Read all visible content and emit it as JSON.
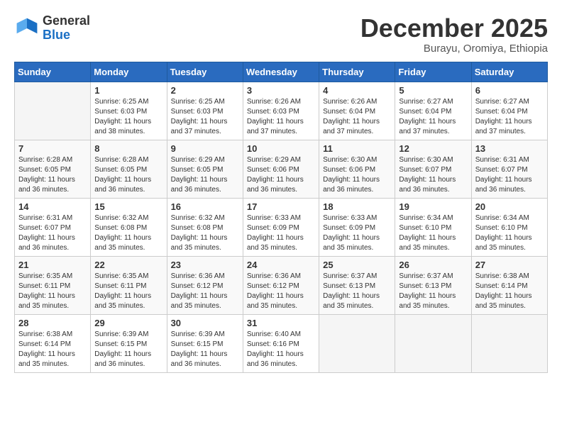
{
  "header": {
    "logo_general": "General",
    "logo_blue": "Blue",
    "month": "December 2025",
    "location": "Burayu, Oromiya, Ethiopia"
  },
  "weekdays": [
    "Sunday",
    "Monday",
    "Tuesday",
    "Wednesday",
    "Thursday",
    "Friday",
    "Saturday"
  ],
  "weeks": [
    [
      {
        "day": "",
        "info": ""
      },
      {
        "day": "1",
        "info": "Sunrise: 6:25 AM\nSunset: 6:03 PM\nDaylight: 11 hours\nand 38 minutes."
      },
      {
        "day": "2",
        "info": "Sunrise: 6:25 AM\nSunset: 6:03 PM\nDaylight: 11 hours\nand 37 minutes."
      },
      {
        "day": "3",
        "info": "Sunrise: 6:26 AM\nSunset: 6:03 PM\nDaylight: 11 hours\nand 37 minutes."
      },
      {
        "day": "4",
        "info": "Sunrise: 6:26 AM\nSunset: 6:04 PM\nDaylight: 11 hours\nand 37 minutes."
      },
      {
        "day": "5",
        "info": "Sunrise: 6:27 AM\nSunset: 6:04 PM\nDaylight: 11 hours\nand 37 minutes."
      },
      {
        "day": "6",
        "info": "Sunrise: 6:27 AM\nSunset: 6:04 PM\nDaylight: 11 hours\nand 37 minutes."
      }
    ],
    [
      {
        "day": "7",
        "info": "Sunrise: 6:28 AM\nSunset: 6:05 PM\nDaylight: 11 hours\nand 36 minutes."
      },
      {
        "day": "8",
        "info": "Sunrise: 6:28 AM\nSunset: 6:05 PM\nDaylight: 11 hours\nand 36 minutes."
      },
      {
        "day": "9",
        "info": "Sunrise: 6:29 AM\nSunset: 6:05 PM\nDaylight: 11 hours\nand 36 minutes."
      },
      {
        "day": "10",
        "info": "Sunrise: 6:29 AM\nSunset: 6:06 PM\nDaylight: 11 hours\nand 36 minutes."
      },
      {
        "day": "11",
        "info": "Sunrise: 6:30 AM\nSunset: 6:06 PM\nDaylight: 11 hours\nand 36 minutes."
      },
      {
        "day": "12",
        "info": "Sunrise: 6:30 AM\nSunset: 6:07 PM\nDaylight: 11 hours\nand 36 minutes."
      },
      {
        "day": "13",
        "info": "Sunrise: 6:31 AM\nSunset: 6:07 PM\nDaylight: 11 hours\nand 36 minutes."
      }
    ],
    [
      {
        "day": "14",
        "info": "Sunrise: 6:31 AM\nSunset: 6:07 PM\nDaylight: 11 hours\nand 36 minutes."
      },
      {
        "day": "15",
        "info": "Sunrise: 6:32 AM\nSunset: 6:08 PM\nDaylight: 11 hours\nand 35 minutes."
      },
      {
        "day": "16",
        "info": "Sunrise: 6:32 AM\nSunset: 6:08 PM\nDaylight: 11 hours\nand 35 minutes."
      },
      {
        "day": "17",
        "info": "Sunrise: 6:33 AM\nSunset: 6:09 PM\nDaylight: 11 hours\nand 35 minutes."
      },
      {
        "day": "18",
        "info": "Sunrise: 6:33 AM\nSunset: 6:09 PM\nDaylight: 11 hours\nand 35 minutes."
      },
      {
        "day": "19",
        "info": "Sunrise: 6:34 AM\nSunset: 6:10 PM\nDaylight: 11 hours\nand 35 minutes."
      },
      {
        "day": "20",
        "info": "Sunrise: 6:34 AM\nSunset: 6:10 PM\nDaylight: 11 hours\nand 35 minutes."
      }
    ],
    [
      {
        "day": "21",
        "info": "Sunrise: 6:35 AM\nSunset: 6:11 PM\nDaylight: 11 hours\nand 35 minutes."
      },
      {
        "day": "22",
        "info": "Sunrise: 6:35 AM\nSunset: 6:11 PM\nDaylight: 11 hours\nand 35 minutes."
      },
      {
        "day": "23",
        "info": "Sunrise: 6:36 AM\nSunset: 6:12 PM\nDaylight: 11 hours\nand 35 minutes."
      },
      {
        "day": "24",
        "info": "Sunrise: 6:36 AM\nSunset: 6:12 PM\nDaylight: 11 hours\nand 35 minutes."
      },
      {
        "day": "25",
        "info": "Sunrise: 6:37 AM\nSunset: 6:13 PM\nDaylight: 11 hours\nand 35 minutes."
      },
      {
        "day": "26",
        "info": "Sunrise: 6:37 AM\nSunset: 6:13 PM\nDaylight: 11 hours\nand 35 minutes."
      },
      {
        "day": "27",
        "info": "Sunrise: 6:38 AM\nSunset: 6:14 PM\nDaylight: 11 hours\nand 35 minutes."
      }
    ],
    [
      {
        "day": "28",
        "info": "Sunrise: 6:38 AM\nSunset: 6:14 PM\nDaylight: 11 hours\nand 35 minutes."
      },
      {
        "day": "29",
        "info": "Sunrise: 6:39 AM\nSunset: 6:15 PM\nDaylight: 11 hours\nand 36 minutes."
      },
      {
        "day": "30",
        "info": "Sunrise: 6:39 AM\nSunset: 6:15 PM\nDaylight: 11 hours\nand 36 minutes."
      },
      {
        "day": "31",
        "info": "Sunrise: 6:40 AM\nSunset: 6:16 PM\nDaylight: 11 hours\nand 36 minutes."
      },
      {
        "day": "",
        "info": ""
      },
      {
        "day": "",
        "info": ""
      },
      {
        "day": "",
        "info": ""
      }
    ]
  ]
}
